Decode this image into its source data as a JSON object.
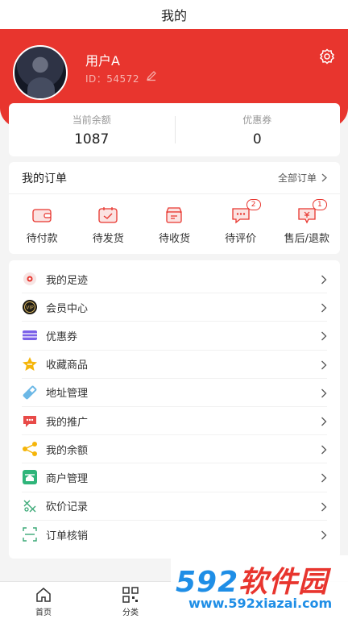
{
  "header": {
    "title": "我的"
  },
  "profile": {
    "username": "用户A",
    "id_text": "ID：54572"
  },
  "stats": [
    {
      "label": "当前余额",
      "value": "1087"
    },
    {
      "label": "优惠券",
      "value": "0"
    }
  ],
  "orders": {
    "title": "我的订单",
    "all_label": "全部订单",
    "items": [
      {
        "label": "待付款",
        "icon": "wallet-icon",
        "badge": ""
      },
      {
        "label": "待发货",
        "icon": "calendar-check-icon",
        "badge": ""
      },
      {
        "label": "待收货",
        "icon": "box-icon",
        "badge": ""
      },
      {
        "label": "待评价",
        "icon": "chat-icon",
        "badge": "2"
      },
      {
        "label": "售后/退款",
        "icon": "refund-icon",
        "badge": "1"
      }
    ]
  },
  "menu": [
    {
      "label": "我的足迹",
      "icon": "footprint-icon"
    },
    {
      "label": "会员中心",
      "icon": "vip-icon"
    },
    {
      "label": "优惠券",
      "icon": "coupon-icon"
    },
    {
      "label": "收藏商品",
      "icon": "star-icon"
    },
    {
      "label": "地址管理",
      "icon": "address-icon"
    },
    {
      "label": "我的推广",
      "icon": "promotion-icon"
    },
    {
      "label": "我的余额",
      "icon": "share-balance-icon"
    },
    {
      "label": "商户管理",
      "icon": "merchant-icon"
    },
    {
      "label": "砍价记录",
      "icon": "bargain-icon"
    },
    {
      "label": "订单核销",
      "icon": "scan-icon"
    }
  ],
  "tabbar": [
    {
      "label": "首页",
      "icon": "home-icon"
    },
    {
      "label": "分类",
      "icon": "qrcode-icon"
    }
  ],
  "watermark": {
    "brand_num": "592",
    "brand_text": "软件园",
    "url": "www.592xiazai.com"
  },
  "colors": {
    "accent": "#e8352e",
    "background": "#f4f4f4",
    "watermark_blue": "#1f8ee6"
  }
}
